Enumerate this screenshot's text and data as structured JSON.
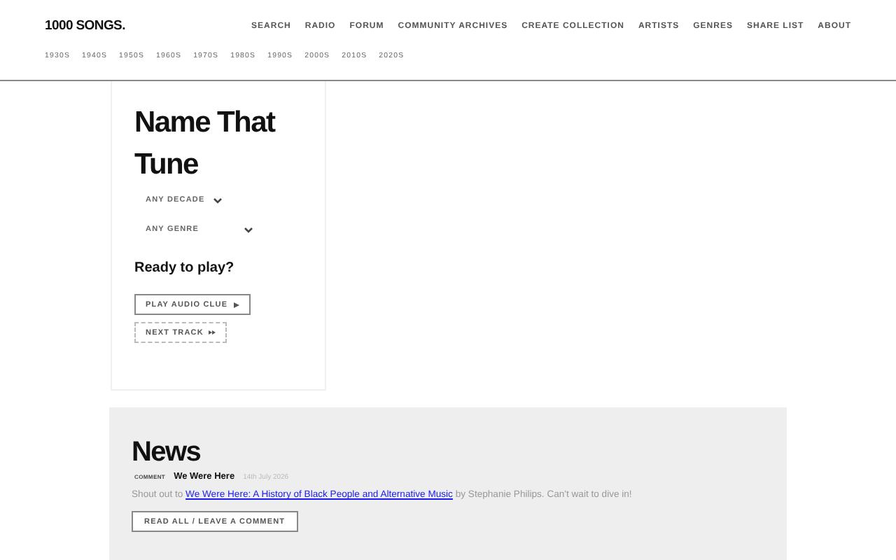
{
  "header": {
    "logo": "1000 SONGS.",
    "nav": [
      "SEARCH",
      "RADIO",
      "FORUM",
      "COMMUNITY ARCHIVES",
      "CREATE COLLECTION",
      "ARTISTS",
      "GENRES",
      "SHARE LIST",
      "ABOUT"
    ],
    "decades": [
      "1930S",
      "1940S",
      "1950S",
      "1960S",
      "1970S",
      "1980S",
      "1990S",
      "2000S",
      "2010S",
      "2020S"
    ]
  },
  "game": {
    "title": "Name That Tune",
    "decade_select": "ANY DECADE",
    "genre_select": "ANY GENRE",
    "prompt": "Ready to play?",
    "play_button": "PLAY AUDIO CLUE",
    "next_button": "NEXT TRACK"
  },
  "news": {
    "title": "News",
    "tag": "COMMENT",
    "author": "We Were Here",
    "date": "14th July 2026",
    "text_before": "Shout out to",
    "link": "We Were Here: A History of Black People and Alternative Music",
    "text_after": "by Stephanie Philips. Can't wait to dive in!",
    "button": "READ ALL / LEAVE A COMMENT"
  }
}
